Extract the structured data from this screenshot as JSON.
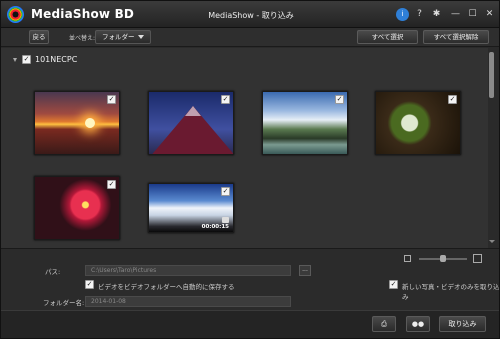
{
  "app": {
    "name": "MediaShow BD",
    "window_title": "MediaShow - 取り込み"
  },
  "titlebar_icons": [
    "info-icon",
    "help-icon",
    "gear-icon",
    "minimize-icon",
    "maximize-icon",
    "close-icon"
  ],
  "titlebar_glyphs": {
    "help": "?",
    "gear": "✱",
    "minimize": "—",
    "maximize": "☐",
    "close": "✕",
    "info": "i"
  },
  "toolbar": {
    "back_label": "戻る",
    "sort_label": "並べ替え:",
    "sort_value": "フォルダー",
    "select_all_label": "すべて選択",
    "deselect_all_label": "すべて選択解除"
  },
  "folder": {
    "name": "101NECPC",
    "checked": true
  },
  "thumbnails": [
    {
      "subject": "sunset-over-sea",
      "checked": true
    },
    {
      "subject": "mountain-at-dusk",
      "checked": true
    },
    {
      "subject": "mountain-river-valley",
      "checked": true
    },
    {
      "subject": "white-flowers",
      "checked": true
    },
    {
      "subject": "red-flowers",
      "checked": true
    },
    {
      "subject": "cloudy-sky-video",
      "checked": true,
      "duration": "00:00:15"
    }
  ],
  "bottom": {
    "path_label": "パス:",
    "path_value": "C:\\Users\\Taro\\Pictures",
    "browse_label": "...",
    "auto_save_label": "ビデオをビデオフォルダーへ自動的に保存する",
    "auto_save_checked": true,
    "folder_name_label": "フォルダー名:",
    "folder_name_value": "2014-01-08",
    "new_only_label": "新しい写真・ビデオのみを取り込み",
    "new_only_checked": true,
    "import_label": "取り込み",
    "check_glyph": "✓"
  },
  "colors": {
    "background": "#2a2a2a",
    "accent": "#2f7fd6"
  }
}
